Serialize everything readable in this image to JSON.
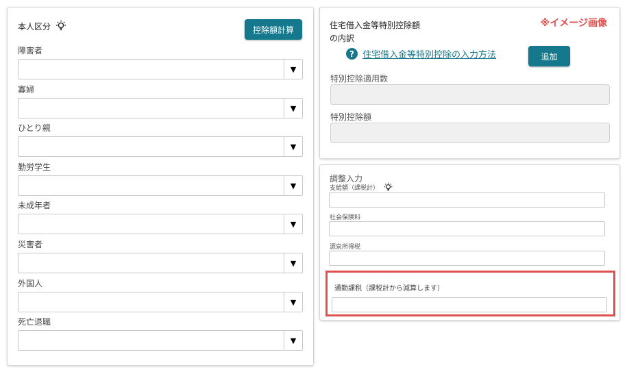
{
  "left_panel": {
    "title": "本人区分",
    "calc_button": "控除額計算",
    "fields": [
      {
        "label": "障害者",
        "value": ""
      },
      {
        "label": "寡婦",
        "value": ""
      },
      {
        "label": "ひとり親",
        "value": ""
      },
      {
        "label": "勤労学生",
        "value": ""
      },
      {
        "label": "未成年者",
        "value": ""
      },
      {
        "label": "災害者",
        "value": ""
      },
      {
        "label": "外国人",
        "value": ""
      },
      {
        "label": "死亡退職",
        "value": ""
      }
    ],
    "dropdown_arrow": "▼"
  },
  "housing_panel": {
    "title_line1": "住宅借入金等特別控除額",
    "title_line2": "の内訳",
    "note": "※イメージ画像",
    "help_icon": "?",
    "help_link": "住宅借入金等特別控除の入力方法",
    "add_button": "追加",
    "count_label": "特別控除適用数",
    "amount_label": "特別控除額"
  },
  "adjust_panel": {
    "title": "調整入力",
    "payment_label": "支給額（課税計）",
    "social_label": "社会保険料",
    "tax_label": "源泉所得税",
    "commute_label": "通勤課税（課税計から減算します）"
  },
  "colors": {
    "accent": "#16788c",
    "highlight": "#e0504e"
  }
}
